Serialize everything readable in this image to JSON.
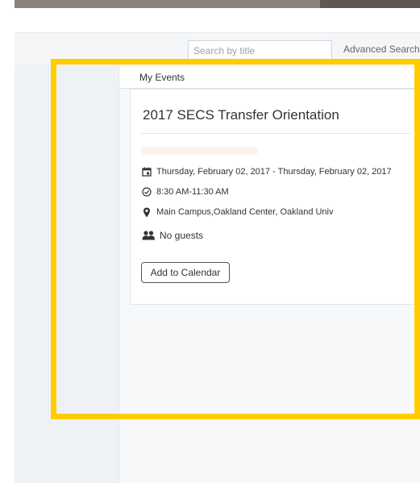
{
  "search": {
    "placeholder": "Search by title"
  },
  "header": {
    "advanced_search": "Advanced Search"
  },
  "section": {
    "title": "My Events"
  },
  "event": {
    "title": "2017 SECS Transfer Orientation",
    "date_range": "Thursday, February 02, 2017  -  Thursday, February 02, 2017",
    "time": "8:30 AM-11:30 AM",
    "location": "Main Campus,Oakland Center, Oakland Univ",
    "guests": "No guests",
    "add_to_calendar": "Add to Calendar"
  },
  "colors": {
    "highlight": "#ffcc00",
    "topbar": "#8a827c"
  },
  "icons": [
    "calendar-icon",
    "clock-icon",
    "map-pin-icon",
    "guests-icon"
  ]
}
